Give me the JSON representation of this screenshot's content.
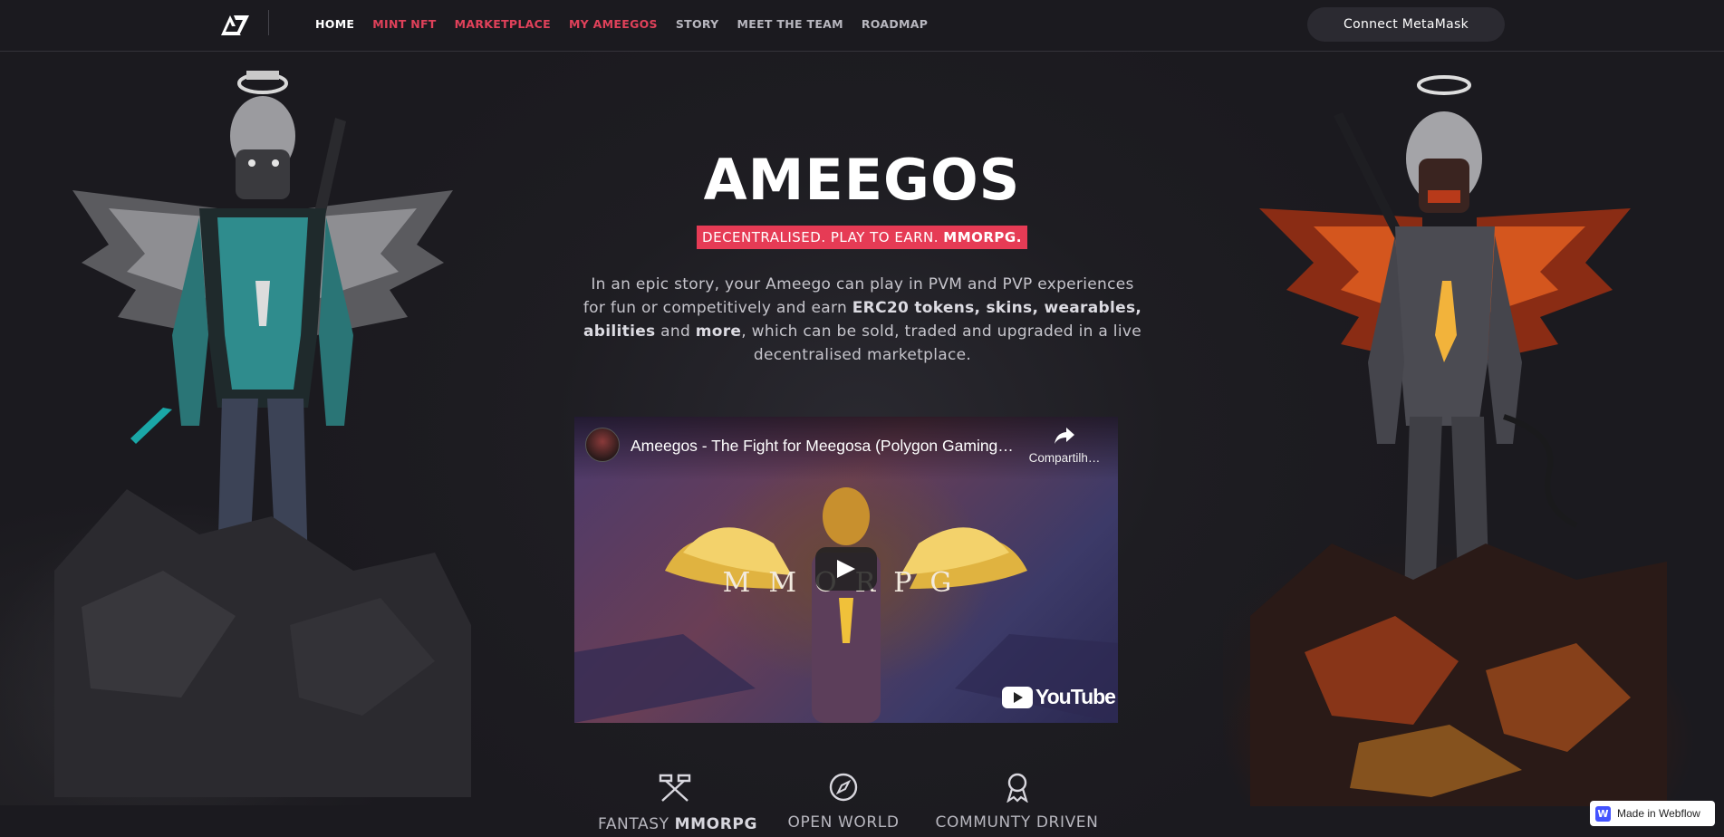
{
  "nav": {
    "logo_icon": "ameegos-logo-icon",
    "links": [
      {
        "label": "HOME",
        "state": "active"
      },
      {
        "label": "MINT NFT",
        "state": "accent"
      },
      {
        "label": "MARKETPLACE",
        "state": "accent"
      },
      {
        "label": "MY AMEEGOS",
        "state": "accent"
      },
      {
        "label": "STORY",
        "state": "default"
      },
      {
        "label": "MEET THE TEAM",
        "state": "default"
      },
      {
        "label": "ROADMAP",
        "state": "default"
      }
    ],
    "connect_label": "Connect MetaMask"
  },
  "hero": {
    "title": "AMEEGOS",
    "tagline_plain": "DECENTRALISED. PLAY TO EARN. ",
    "tagline_bold": "MMORPG.",
    "intro": {
      "p1": "In an epic story, your Ameego can play in PVM and PVP experiences for fun or competitively and earn ",
      "b1": "ERC20 tokens, skins, wearables, abilities",
      "p2": " and ",
      "b2": "more",
      "p3": ", which can be sold, traded and upgraded in a live decentralised marketplace."
    }
  },
  "video": {
    "title": "Ameegos - The Fight for Meegosa (Polygon Gaming…",
    "share_label": "Compartilh…",
    "overlay_text": "MMORPG",
    "logo_text": "YouTube"
  },
  "features": [
    {
      "icon": "crossed-hammers-icon",
      "plain": "FANTASY ",
      "bold": "MMORPG"
    },
    {
      "icon": "compass-icon",
      "plain": "OPEN WORLD",
      "bold": ""
    },
    {
      "icon": "award-ribbon-icon",
      "plain": "COMMUNTY DRIVEN",
      "bold": ""
    }
  ],
  "badge": {
    "mark": "W",
    "label": "Made in Webflow"
  },
  "colors": {
    "background": "#1b1a1f",
    "accent": "#e63b55",
    "nav_accent": "#e0415a",
    "button_bg": "#2b2a31"
  }
}
